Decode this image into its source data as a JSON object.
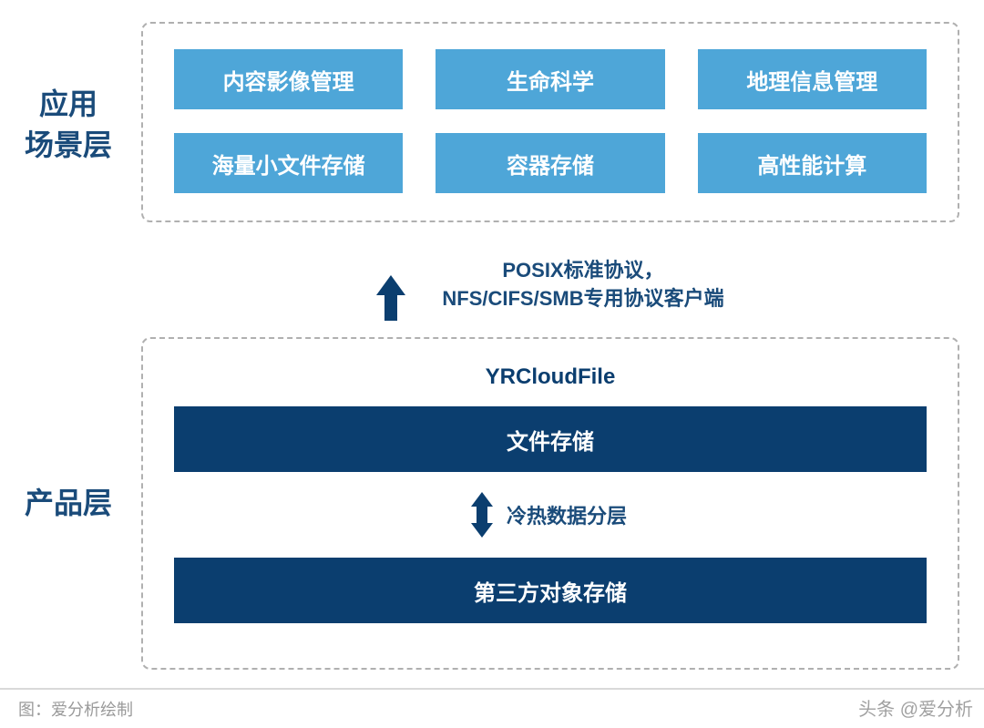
{
  "layers": {
    "app": {
      "label": "应用\n场景层",
      "tiles": [
        "内容影像管理",
        "生命科学",
        "地理信息管理",
        "海量小文件存储",
        "容器存储",
        "高性能计算"
      ]
    },
    "product": {
      "label": "产品层",
      "subtitle": "YRCloudFile",
      "bar1": "文件存储",
      "tier_label": "冷热数据分层",
      "bar2": "第三方对象存储"
    }
  },
  "connector": {
    "line1": "POSIX标准协议，",
    "line2": "NFS/CIFS/SMB专用协议客户端"
  },
  "footer": {
    "caption": "图：爱分析绘制"
  },
  "watermark": "头条 @爱分析"
}
